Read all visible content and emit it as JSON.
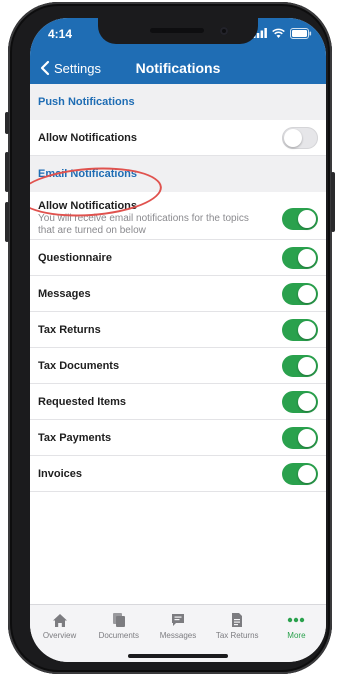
{
  "status_bar": {
    "time": "4:14"
  },
  "nav": {
    "back_label": "Settings",
    "title": "Notifications"
  },
  "sections": {
    "push": {
      "header": "Push Notifications",
      "allow_label": "Allow Notifications",
      "allow_on": false
    },
    "email": {
      "header": "Email Notifications",
      "allow_label": "Allow Notifications",
      "allow_desc": "You will receive email notifications for the topics that are turned on below",
      "allow_on": true,
      "items": [
        {
          "label": "Questionnaire",
          "on": true
        },
        {
          "label": "Messages",
          "on": true
        },
        {
          "label": "Tax Returns",
          "on": true
        },
        {
          "label": "Tax Documents",
          "on": true
        },
        {
          "label": "Requested Items",
          "on": true
        },
        {
          "label": "Tax Payments",
          "on": true
        },
        {
          "label": "Invoices",
          "on": true
        }
      ]
    }
  },
  "tabbar": {
    "active": "More",
    "tabs": [
      {
        "label": "Overview",
        "icon": "home-icon"
      },
      {
        "label": "Documents",
        "icon": "documents-icon"
      },
      {
        "label": "Messages",
        "icon": "chat-icon"
      },
      {
        "label": "Tax Returns",
        "icon": "tax-returns-icon"
      },
      {
        "label": "More",
        "icon": "more-icon"
      }
    ]
  },
  "colors": {
    "brand": "#1f6db4",
    "toggle_on": "#2aa14d",
    "annotation": "#e0524e"
  }
}
